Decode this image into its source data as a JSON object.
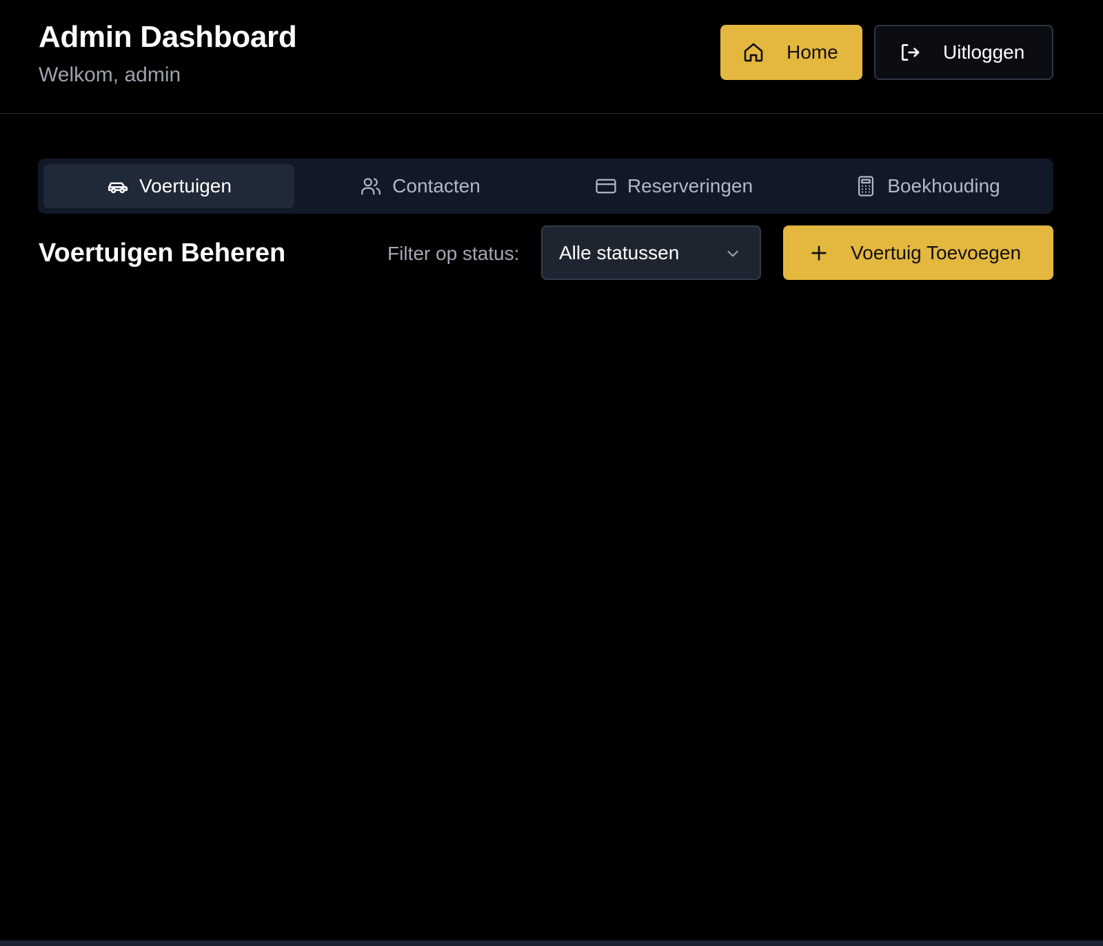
{
  "header": {
    "title": "Admin Dashboard",
    "subtitle": "Welkom, admin",
    "home_label": "Home",
    "logout_label": "Uitloggen"
  },
  "tabs": [
    {
      "label": "Voertuigen",
      "icon": "car-icon",
      "active": true
    },
    {
      "label": "Contacten",
      "icon": "users-icon",
      "active": false
    },
    {
      "label": "Reserveringen",
      "icon": "credit-card-icon",
      "active": false
    },
    {
      "label": "Boekhouding",
      "icon": "calculator-icon",
      "active": false
    }
  ],
  "section": {
    "title": "Voertuigen Beheren",
    "filter_label": "Filter op status:",
    "filter_value": "Alle statussen",
    "add_label": "Voertuig Toevoegen"
  },
  "colors": {
    "accent": "#e4b73f",
    "background": "#000000",
    "tab_bar": "#111827",
    "tab_active": "#1f2937",
    "muted_text": "#9ca3af"
  }
}
